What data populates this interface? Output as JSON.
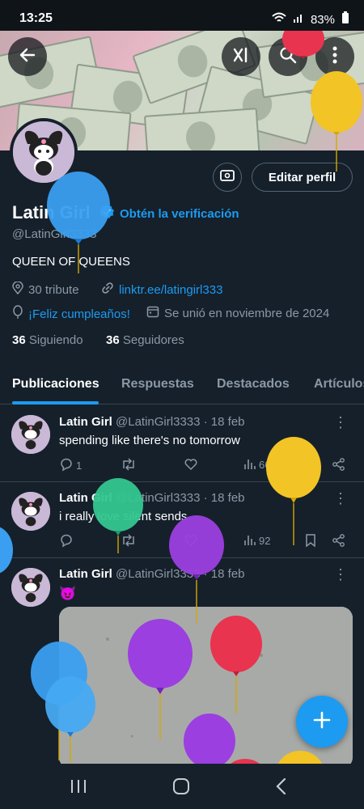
{
  "status_bar": {
    "time": "13:25",
    "battery": "83%"
  },
  "profile": {
    "name": "Latin Girl",
    "verify_label": "Obtén la verificación",
    "handle": "@LatinGirl3333",
    "bio": "QUEEN OF QUEENS",
    "tribute": "30 tribute",
    "link": "linktr.ee/latingirl333",
    "birthday": "¡Feliz cumpleaños!",
    "joined": "Se unió en noviembre de 2024",
    "following_count": "36",
    "following_label": "Siguiendo",
    "followers_count": "36",
    "followers_label": "Seguidores",
    "edit_label": "Editar perfil"
  },
  "tabs": [
    "Publicaciones",
    "Respuestas",
    "Destacados",
    "Artículos"
  ],
  "posts": [
    {
      "author": "Latin Girl",
      "handle": "@LatinGirl3333",
      "date": "· 18 feb",
      "text": "spending like there's no tomorrow",
      "replies": "1",
      "views": "66"
    },
    {
      "author": "Latin Girl",
      "handle": "@LatinGirl3333",
      "date": "· 18 feb",
      "text": "i really love silent sends",
      "replies": "",
      "views": "92"
    },
    {
      "author": "Latin Girl",
      "handle": "@LatinGirl3333",
      "date": "· 18 feb",
      "text": "😈"
    }
  ],
  "colors": {
    "background": "#15202b",
    "accent": "#1d9bf0",
    "muted": "#8b98a5",
    "border": "#38444d"
  },
  "icons": [
    "back-arrow-icon",
    "grok-icon",
    "search-icon",
    "more-vertical-icon",
    "wallet-icon",
    "verified-badge-icon",
    "location-icon",
    "link-icon",
    "balloon-icon",
    "calendar-icon",
    "reply-icon",
    "retweet-icon",
    "like-icon",
    "views-icon",
    "bookmark-icon",
    "share-icon",
    "compose-plus-icon",
    "recent-apps-icon",
    "home-nav-icon",
    "back-nav-icon"
  ]
}
